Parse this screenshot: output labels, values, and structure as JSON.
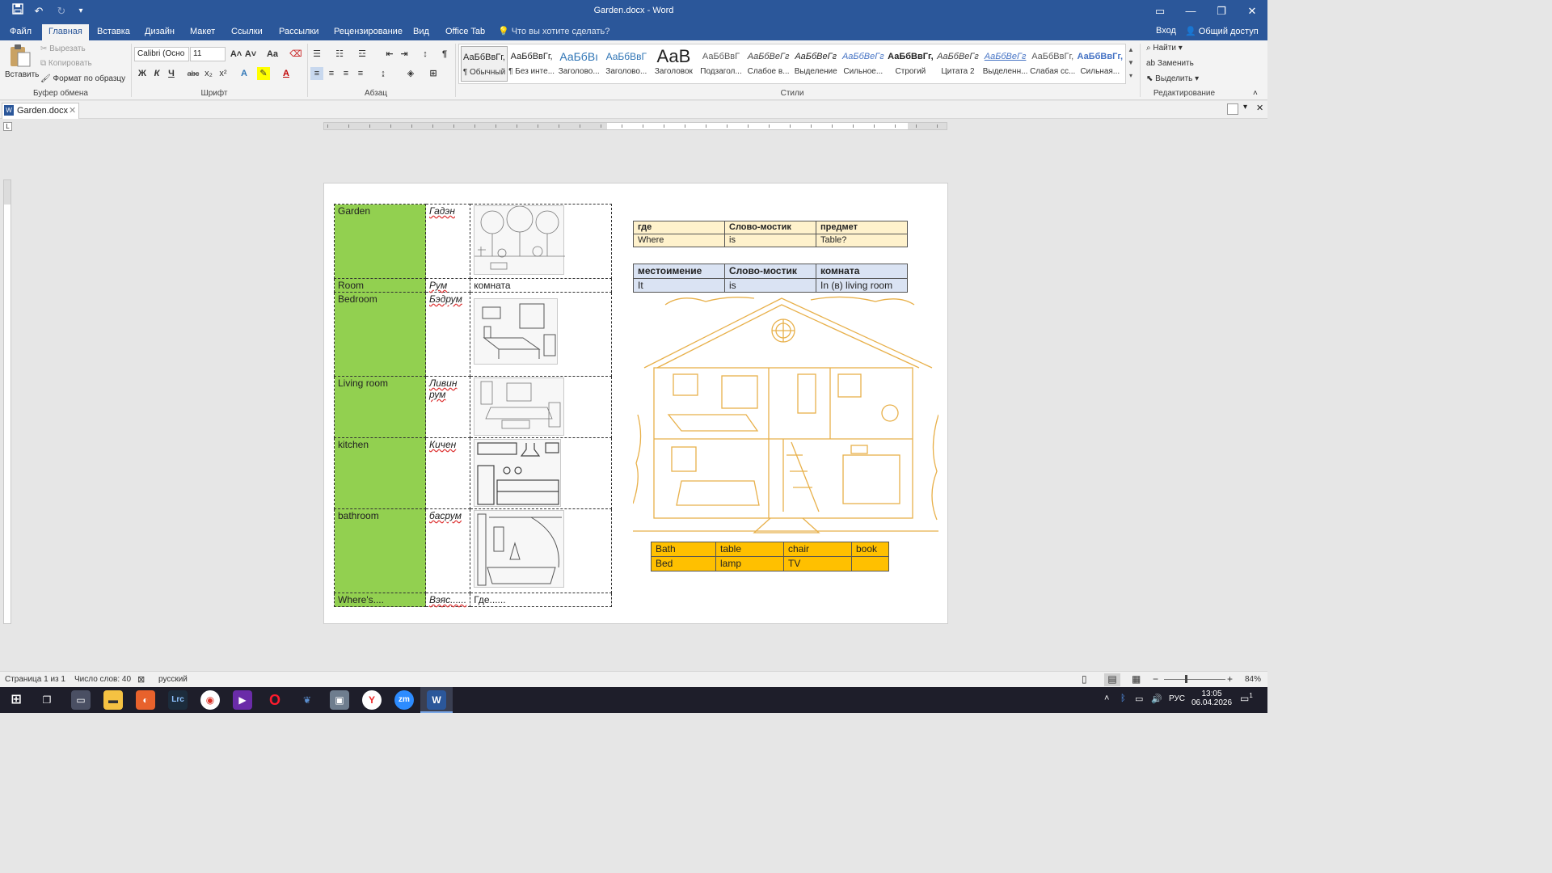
{
  "window": {
    "title": "Garden.docx - Word",
    "quick_access": [
      "save-icon",
      "undo-icon",
      "redo-icon",
      "customize-icon"
    ]
  },
  "tabs": [
    "Файл",
    "Главная",
    "Вставка",
    "Дизайн",
    "Макет",
    "Ссылки",
    "Рассылки",
    "Рецензирование",
    "Вид",
    "Office Tab"
  ],
  "tell_me": "Что вы хотите сделать?",
  "account": {
    "signin": "Вход",
    "share": "Общий доступ"
  },
  "ribbon": {
    "clipboard": {
      "paste": "Вставить",
      "cut": "Вырезать",
      "copy": "Копировать",
      "format_painter": "Формат по образцу",
      "label": "Буфер обмена"
    },
    "font": {
      "name": "Calibri (Осно",
      "size": "11",
      "label": "Шрифт",
      "bold": "Ж",
      "italic": "К",
      "underline": "Ч",
      "strike": "abc",
      "sub": "x₂",
      "sup": "x²",
      "case": "Aa"
    },
    "paragraph": {
      "label": "Абзац"
    },
    "styles": {
      "label": "Стили",
      "items": [
        {
          "preview": "АаБбВвГг,",
          "name": "¶ Обычный"
        },
        {
          "preview": "АаБбВвГг,",
          "name": "¶ Без инте..."
        },
        {
          "preview": "АаБбВı",
          "name": "Заголово..."
        },
        {
          "preview": "АаБбВвГ",
          "name": "Заголово..."
        },
        {
          "preview": "АаВ",
          "name": "Заголовок"
        },
        {
          "preview": "АаБбВвГ",
          "name": "Подзагол..."
        },
        {
          "preview": "АаБбВеГг",
          "name": "Слабое в..."
        },
        {
          "preview": "АаБбВеГг",
          "name": "Выделение"
        },
        {
          "preview": "АаБбВеГг",
          "name": "Сильное..."
        },
        {
          "preview": "АаБбВвГг,",
          "name": "Строгий"
        },
        {
          "preview": "АаБбВеГг",
          "name": "Цитата 2"
        },
        {
          "preview": "АаБбВеГг",
          "name": "Выделенн..."
        },
        {
          "preview": "АаБбВвГг,",
          "name": "Слабая сс..."
        },
        {
          "preview": "АаБбВвГг,",
          "name": "Сильная..."
        }
      ]
    },
    "editing": {
      "label": "Редактирование",
      "find": "Найти",
      "replace": "Заменить",
      "select": "Выделить"
    }
  },
  "document_tab": "Garden.docx",
  "vocab_table": [
    {
      "en": "Garden",
      "tr": "Гадэн",
      "pic": "garden-picture",
      "ru": ""
    },
    {
      "en": "Room",
      "tr": "Рум",
      "pic": "",
      "ru": "комната"
    },
    {
      "en": "Bedroom",
      "tr": "Бэдрум",
      "pic": "bedroom-picture",
      "ru": ""
    },
    {
      "en": "Living room",
      "tr": "Ливин рум",
      "pic": "living-room-picture",
      "ru": ""
    },
    {
      "en": "kitchen",
      "tr": "Кичен",
      "pic": "kitchen-picture",
      "ru": ""
    },
    {
      "en": "bathroom",
      "tr": "басрум",
      "pic": "bathroom-picture",
      "ru": ""
    },
    {
      "en": "Where's....",
      "tr": "Вэяс......",
      "pic": "",
      "ru": "Где......"
    }
  ],
  "grammar_table1": {
    "header": [
      "где",
      "Слово-мостик",
      "предмет"
    ],
    "row": [
      "Where",
      "is",
      "Table?"
    ]
  },
  "grammar_table2": {
    "header": [
      "местоимение",
      "Слово-мостик",
      "комната"
    ],
    "row": [
      "It",
      "is",
      "In (в) living room"
    ]
  },
  "words_table": [
    [
      "Bath",
      "table",
      "chair",
      "book"
    ],
    [
      "Bed",
      "lamp",
      "TV",
      ""
    ]
  ],
  "status": {
    "page": "Страница 1 из 1",
    "words": "Число слов: 40",
    "language": "русский",
    "zoom": "84%"
  },
  "taskbar": {
    "lang": "РУС",
    "time": "13:05",
    "date": "06.04.2026",
    "notifications": "1"
  },
  "colors": {
    "word_blue": "#2b579a",
    "green_cell": "#92d050",
    "yellow_table": "#fff2cc",
    "blue_table": "#dae3f3",
    "orange_table": "#ffc000",
    "house_line": "#e8b04a"
  }
}
